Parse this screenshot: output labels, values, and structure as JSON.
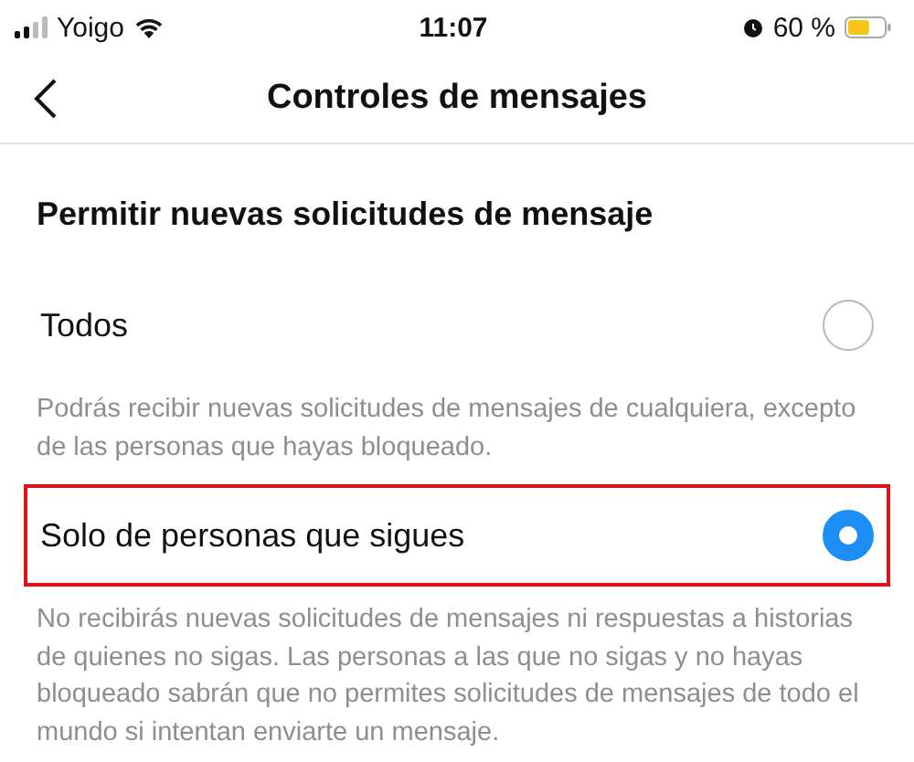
{
  "status_bar": {
    "carrier": "Yoigo",
    "time": "11:07",
    "battery": "60 %"
  },
  "header": {
    "title": "Controles de mensajes"
  },
  "section": {
    "title": "Permitir nuevas solicitudes de mensaje"
  },
  "options": [
    {
      "label": "Todos",
      "selected": false,
      "highlighted": false,
      "description": "Podrás recibir nuevas solicitudes de mensajes de cualquiera, excepto de las personas que hayas bloqueado."
    },
    {
      "label": "Solo de personas que sigues",
      "selected": true,
      "highlighted": true,
      "description": "No recibirás nuevas solicitudes de mensajes ni respuestas a historias de quienes no sigas. Las personas a las que no sigas y no hayas bloqueado sabrán que no permites solicitudes de mensajes de todo el mundo si intentan enviarte un mensaje."
    }
  ]
}
